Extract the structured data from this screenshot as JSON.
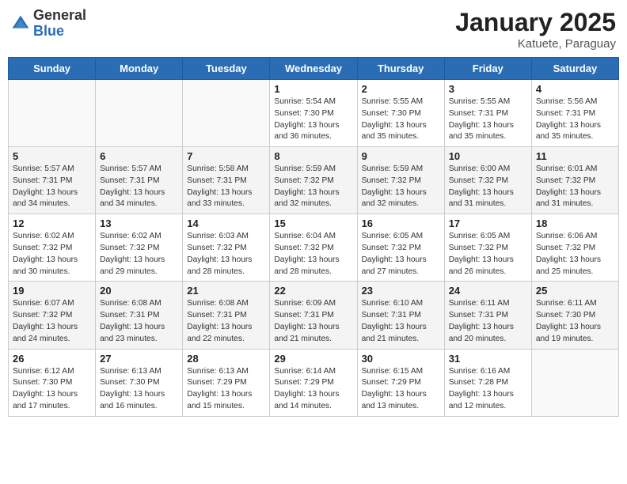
{
  "header": {
    "logo_general": "General",
    "logo_blue": "Blue",
    "title": "January 2025",
    "subtitle": "Katuete, Paraguay"
  },
  "weekdays": [
    "Sunday",
    "Monday",
    "Tuesday",
    "Wednesday",
    "Thursday",
    "Friday",
    "Saturday"
  ],
  "weeks": [
    [
      {
        "day": "",
        "info": ""
      },
      {
        "day": "",
        "info": ""
      },
      {
        "day": "",
        "info": ""
      },
      {
        "day": "1",
        "info": "Sunrise: 5:54 AM\nSunset: 7:30 PM\nDaylight: 13 hours\nand 36 minutes."
      },
      {
        "day": "2",
        "info": "Sunrise: 5:55 AM\nSunset: 7:30 PM\nDaylight: 13 hours\nand 35 minutes."
      },
      {
        "day": "3",
        "info": "Sunrise: 5:55 AM\nSunset: 7:31 PM\nDaylight: 13 hours\nand 35 minutes."
      },
      {
        "day": "4",
        "info": "Sunrise: 5:56 AM\nSunset: 7:31 PM\nDaylight: 13 hours\nand 35 minutes."
      }
    ],
    [
      {
        "day": "5",
        "info": "Sunrise: 5:57 AM\nSunset: 7:31 PM\nDaylight: 13 hours\nand 34 minutes."
      },
      {
        "day": "6",
        "info": "Sunrise: 5:57 AM\nSunset: 7:31 PM\nDaylight: 13 hours\nand 34 minutes."
      },
      {
        "day": "7",
        "info": "Sunrise: 5:58 AM\nSunset: 7:31 PM\nDaylight: 13 hours\nand 33 minutes."
      },
      {
        "day": "8",
        "info": "Sunrise: 5:59 AM\nSunset: 7:32 PM\nDaylight: 13 hours\nand 32 minutes."
      },
      {
        "day": "9",
        "info": "Sunrise: 5:59 AM\nSunset: 7:32 PM\nDaylight: 13 hours\nand 32 minutes."
      },
      {
        "day": "10",
        "info": "Sunrise: 6:00 AM\nSunset: 7:32 PM\nDaylight: 13 hours\nand 31 minutes."
      },
      {
        "day": "11",
        "info": "Sunrise: 6:01 AM\nSunset: 7:32 PM\nDaylight: 13 hours\nand 31 minutes."
      }
    ],
    [
      {
        "day": "12",
        "info": "Sunrise: 6:02 AM\nSunset: 7:32 PM\nDaylight: 13 hours\nand 30 minutes."
      },
      {
        "day": "13",
        "info": "Sunrise: 6:02 AM\nSunset: 7:32 PM\nDaylight: 13 hours\nand 29 minutes."
      },
      {
        "day": "14",
        "info": "Sunrise: 6:03 AM\nSunset: 7:32 PM\nDaylight: 13 hours\nand 28 minutes."
      },
      {
        "day": "15",
        "info": "Sunrise: 6:04 AM\nSunset: 7:32 PM\nDaylight: 13 hours\nand 28 minutes."
      },
      {
        "day": "16",
        "info": "Sunrise: 6:05 AM\nSunset: 7:32 PM\nDaylight: 13 hours\nand 27 minutes."
      },
      {
        "day": "17",
        "info": "Sunrise: 6:05 AM\nSunset: 7:32 PM\nDaylight: 13 hours\nand 26 minutes."
      },
      {
        "day": "18",
        "info": "Sunrise: 6:06 AM\nSunset: 7:32 PM\nDaylight: 13 hours\nand 25 minutes."
      }
    ],
    [
      {
        "day": "19",
        "info": "Sunrise: 6:07 AM\nSunset: 7:32 PM\nDaylight: 13 hours\nand 24 minutes."
      },
      {
        "day": "20",
        "info": "Sunrise: 6:08 AM\nSunset: 7:31 PM\nDaylight: 13 hours\nand 23 minutes."
      },
      {
        "day": "21",
        "info": "Sunrise: 6:08 AM\nSunset: 7:31 PM\nDaylight: 13 hours\nand 22 minutes."
      },
      {
        "day": "22",
        "info": "Sunrise: 6:09 AM\nSunset: 7:31 PM\nDaylight: 13 hours\nand 21 minutes."
      },
      {
        "day": "23",
        "info": "Sunrise: 6:10 AM\nSunset: 7:31 PM\nDaylight: 13 hours\nand 21 minutes."
      },
      {
        "day": "24",
        "info": "Sunrise: 6:11 AM\nSunset: 7:31 PM\nDaylight: 13 hours\nand 20 minutes."
      },
      {
        "day": "25",
        "info": "Sunrise: 6:11 AM\nSunset: 7:30 PM\nDaylight: 13 hours\nand 19 minutes."
      }
    ],
    [
      {
        "day": "26",
        "info": "Sunrise: 6:12 AM\nSunset: 7:30 PM\nDaylight: 13 hours\nand 17 minutes."
      },
      {
        "day": "27",
        "info": "Sunrise: 6:13 AM\nSunset: 7:30 PM\nDaylight: 13 hours\nand 16 minutes."
      },
      {
        "day": "28",
        "info": "Sunrise: 6:13 AM\nSunset: 7:29 PM\nDaylight: 13 hours\nand 15 minutes."
      },
      {
        "day": "29",
        "info": "Sunrise: 6:14 AM\nSunset: 7:29 PM\nDaylight: 13 hours\nand 14 minutes."
      },
      {
        "day": "30",
        "info": "Sunrise: 6:15 AM\nSunset: 7:29 PM\nDaylight: 13 hours\nand 13 minutes."
      },
      {
        "day": "31",
        "info": "Sunrise: 6:16 AM\nSunset: 7:28 PM\nDaylight: 13 hours\nand 12 minutes."
      },
      {
        "day": "",
        "info": ""
      }
    ]
  ]
}
